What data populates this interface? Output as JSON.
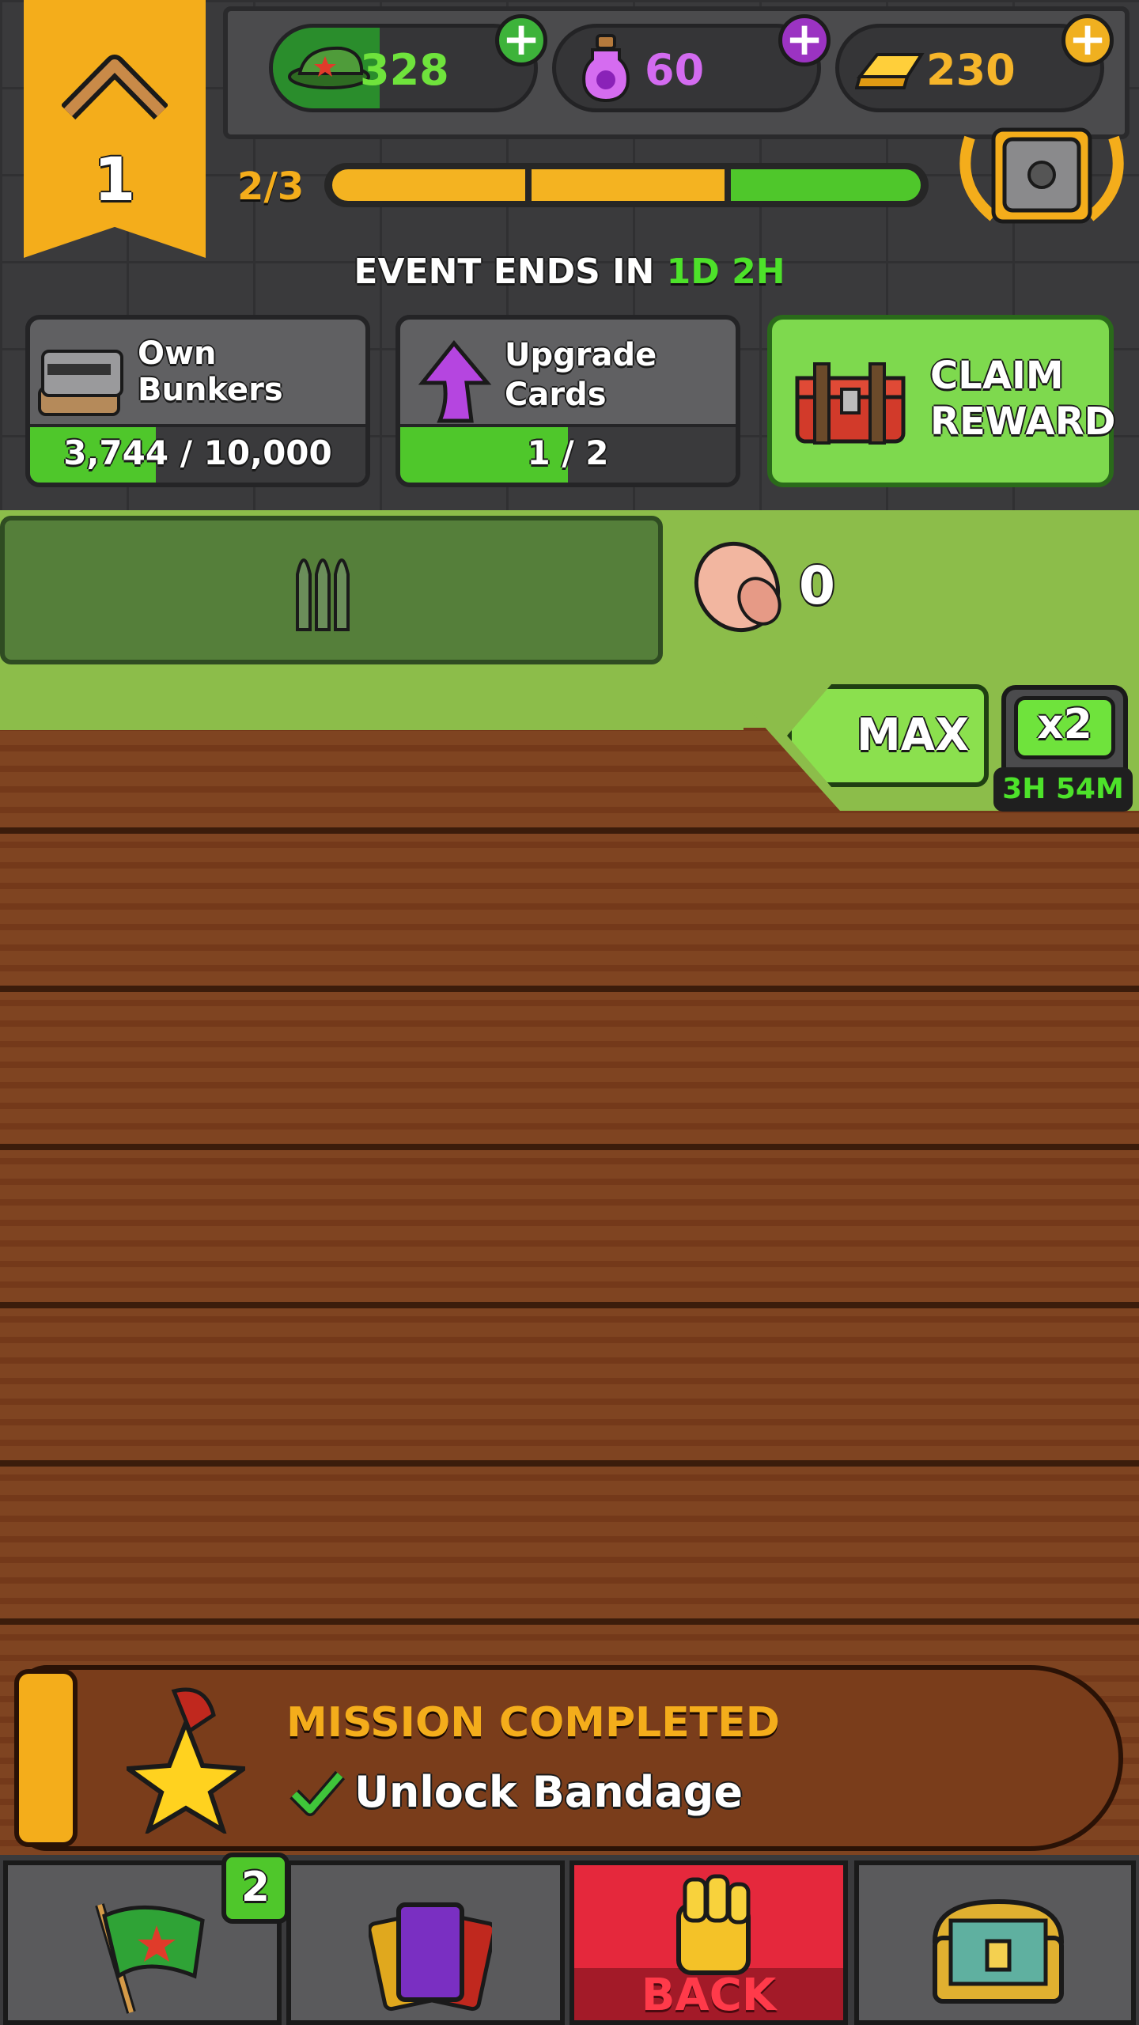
{
  "rank": {
    "level": "1"
  },
  "resources": {
    "caps": {
      "value": "328"
    },
    "potion": {
      "value": "60"
    },
    "gold": {
      "value": "230"
    },
    "plus": "+"
  },
  "level_progress": {
    "text": "2/3",
    "fraction": 0.67
  },
  "event": {
    "prefix": "EVENT ENDS IN",
    "days": "1D",
    "hours": "2H"
  },
  "tasks": [
    {
      "label": "Own Bunkers",
      "progress_text": "3,744 / 10,000",
      "fraction": 0.374
    },
    {
      "label": "Upgrade Cards",
      "progress_text": "1 / 2",
      "fraction": 0.5
    }
  ],
  "claim": {
    "line1": "CLAIM",
    "line2": "REWARD"
  },
  "inventory": {
    "bandage_count": "0"
  },
  "max_button": {
    "label": "MAX"
  },
  "boost": {
    "label": "x2",
    "timer": "3H 54M"
  },
  "mission": {
    "title": "MISSION COMPLETED",
    "task": "Unlock Bandage"
  },
  "nav": {
    "missions_badge": "2",
    "back_label": "BACK"
  },
  "colors": {
    "accent_yellow": "#f4ad1b",
    "green": "#5fd22f",
    "purple": "#c73de0",
    "back_red": "#e5283c"
  }
}
